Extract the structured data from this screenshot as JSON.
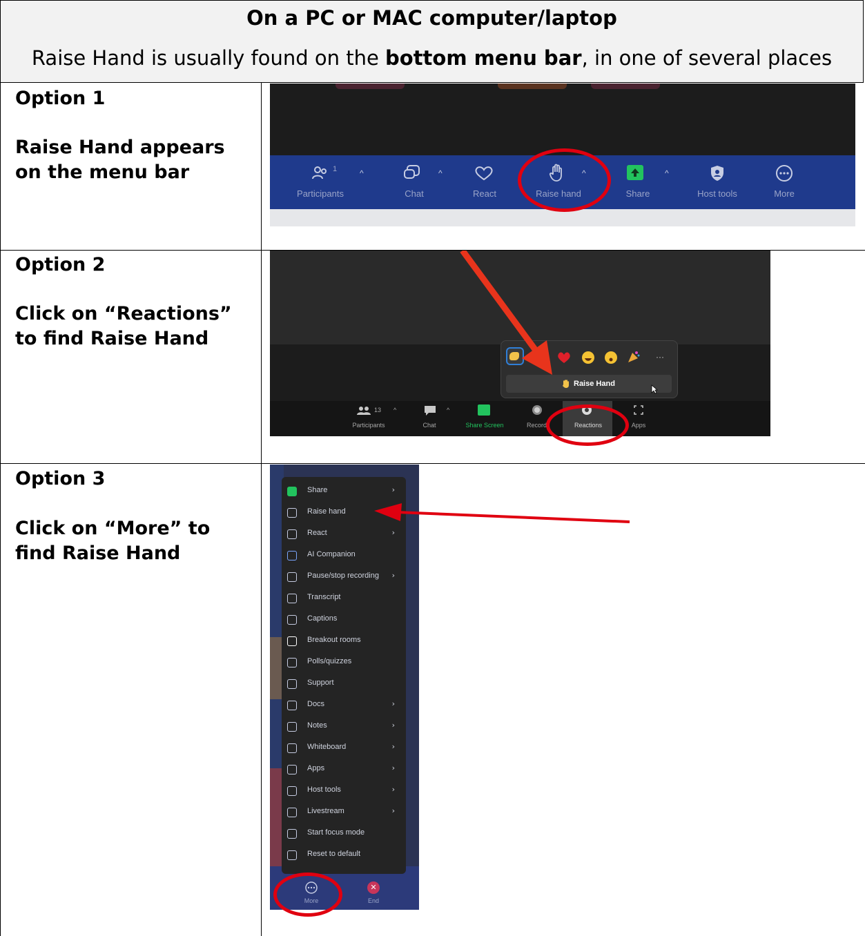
{
  "header": {
    "title": "On a PC or MAC computer/laptop",
    "subtitle_pre": "Raise Hand is usually found on the ",
    "subtitle_bold": "bottom menu bar",
    "subtitle_post": ", in one of several places"
  },
  "options": [
    {
      "title": "Option 1",
      "description": "Raise Hand appears on the menu bar"
    },
    {
      "title": "Option 2",
      "description": "Click on “Reactions” to find Raise Hand"
    },
    {
      "title": "Option 3",
      "description": "Click on “More” to find Raise Hand"
    }
  ],
  "shot1": {
    "participants_count": "1",
    "items": [
      "Participants",
      "Chat",
      "React",
      "Raise hand",
      "Share",
      "Host tools",
      "More"
    ]
  },
  "shot2": {
    "participants_count": "13",
    "items": [
      "Participants",
      "Chat",
      "Share Screen",
      "Record",
      "Reactions",
      "Apps"
    ],
    "popup_button": "Raise Hand",
    "more_dots": "···"
  },
  "shot3": {
    "menu": [
      {
        "label": "Share",
        "arrow": "›"
      },
      {
        "label": "Raise hand",
        "arrow": ""
      },
      {
        "label": "React",
        "arrow": "›"
      },
      {
        "label": "AI Companion",
        "arrow": ""
      },
      {
        "label": "Pause/stop recording",
        "arrow": "›"
      },
      {
        "label": "Transcript",
        "arrow": ""
      },
      {
        "label": "Captions",
        "arrow": ""
      },
      {
        "label": "Breakout rooms",
        "arrow": ""
      },
      {
        "label": "Polls/quizzes",
        "arrow": ""
      },
      {
        "label": "Support",
        "arrow": ""
      },
      {
        "label": "Docs",
        "arrow": "›"
      },
      {
        "label": "Notes",
        "arrow": "›"
      },
      {
        "label": "Whiteboard",
        "arrow": "›"
      },
      {
        "label": "Apps",
        "arrow": "›"
      },
      {
        "label": "Host tools",
        "arrow": "›"
      },
      {
        "label": "Livestream",
        "arrow": "›"
      },
      {
        "label": "Start focus mode",
        "arrow": ""
      },
      {
        "label": "Reset to default",
        "arrow": ""
      }
    ],
    "more_label": "More",
    "end_label": "End"
  },
  "colors": {
    "annotation_red": "#e00010",
    "zoom_blue": "#1f3a8c",
    "zoom_dark": "#1f1f1f",
    "share_green": "#22c35e"
  }
}
